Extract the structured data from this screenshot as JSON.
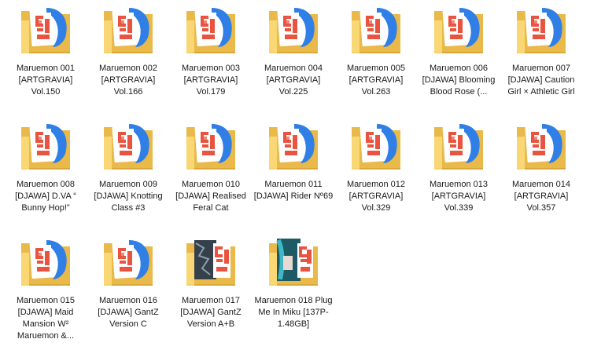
{
  "colors": {
    "folder_back": "#e9b949",
    "folder_front": "#f8d775",
    "doc_blue": "#2f7fe6",
    "doc_red": "#e8543f",
    "doc_paper": "#ffffff",
    "photo_dark": "#35404a"
  },
  "folders": [
    {
      "name": "Maruemon 001 [ARTGRAVIA] Vol.150",
      "preview": "logo-blue-red"
    },
    {
      "name": "Maruemon 002 [ARTGRAVIA] Vol.166",
      "preview": "logo-blue-red"
    },
    {
      "name": "Maruemon 003 [ARTGRAVIA] Vol.179",
      "preview": "logo-blue-red"
    },
    {
      "name": "Maruemon 004 [ARTGRAVIA] Vol.225",
      "preview": "logo-blue-red"
    },
    {
      "name": "Maruemon 005 [ARTGRAVIA] Vol.263",
      "preview": "logo-blue-red"
    },
    {
      "name": "Maruemon 006 [DJAWA] Blooming Blood Rose (...",
      "preview": "logo-blue-red"
    },
    {
      "name": "Maruemon 007 [DJAWA] Caution Girl × Athletic Girl",
      "preview": "logo-blue-red"
    },
    {
      "name": "Maruemon 008 [DJAWA] D.VA “ Bunny Hop!”",
      "preview": "logo-blue-red"
    },
    {
      "name": "Maruemon 009 [DJAWA] Knotting Class #3",
      "preview": "logo-blue-red"
    },
    {
      "name": "Maruemon 010 [DJAWA] Realised Feral Cat",
      "preview": "logo-blue-red"
    },
    {
      "name": "Maruemon 011 [DJAWA] Rider Nº69",
      "preview": "logo-blue-red"
    },
    {
      "name": "Maruemon 012 [ARTGRAVIA] Vol.329",
      "preview": "logo-blue-red"
    },
    {
      "name": "Maruemon 013 [ARTGRAVIA] Vol.339",
      "preview": "logo-blue-red"
    },
    {
      "name": "Maruemon 014 [ARTGRAVIA] Vol.357",
      "preview": "logo-blue-red"
    },
    {
      "name": "Maruemon 015 [DJAWA] Maid Mansion W² Maruemon &...",
      "preview": "logo-blue-red"
    },
    {
      "name": "Maruemon 016 [DJAWA] GantZ Version C",
      "preview": "logo-blue-red"
    },
    {
      "name": "Maruemon 017 [DJAWA] GantZ Version A+B",
      "preview": "photo-dark"
    },
    {
      "name": "Maruemon 018 Plug Me In Miku [137P-1.48GB]",
      "preview": "photo-teal"
    }
  ]
}
